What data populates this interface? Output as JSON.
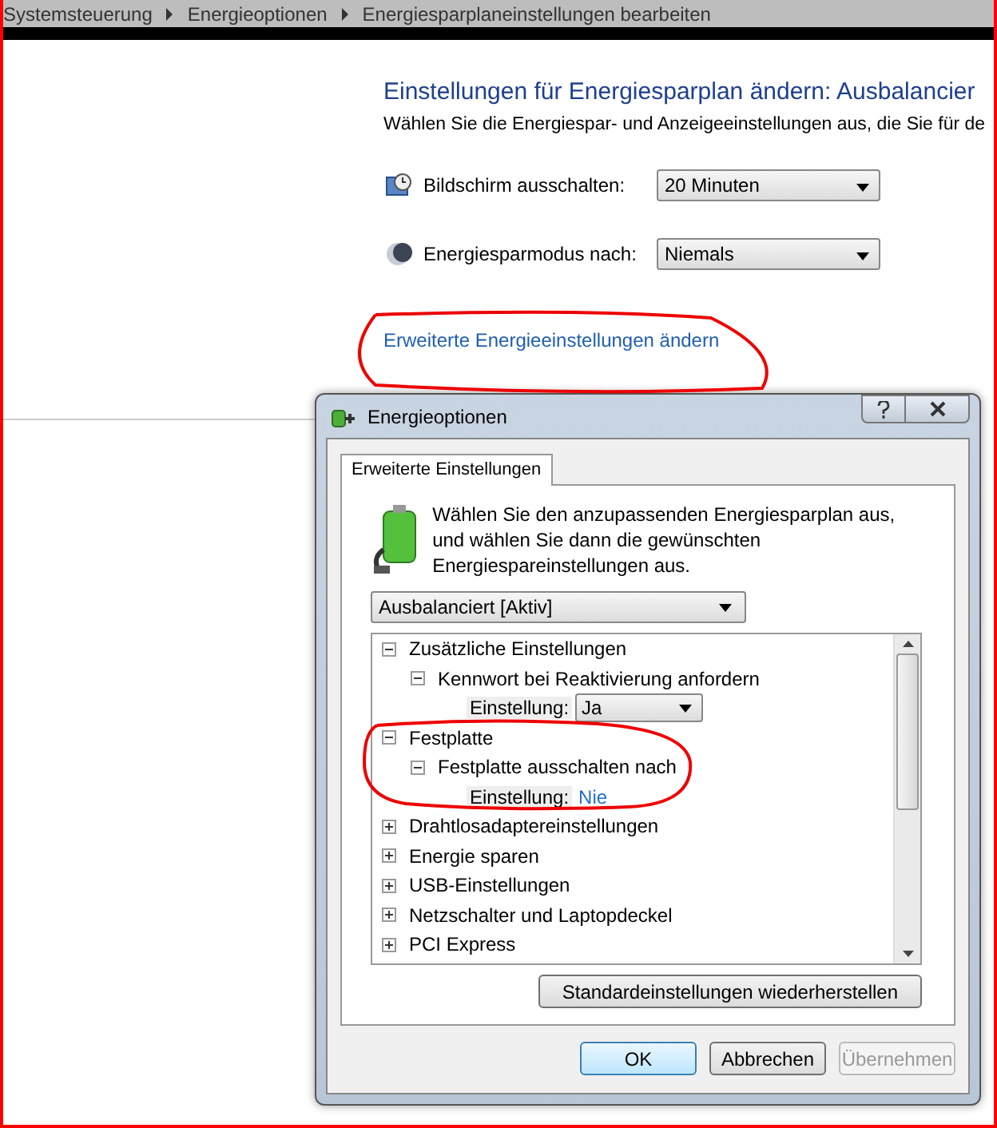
{
  "breadcrumb": [
    {
      "label": "Systemsteuerung"
    },
    {
      "label": "Energieoptionen"
    },
    {
      "label": "Energiesparplaneinstellungen bearbeiten"
    }
  ],
  "page": {
    "title": "Einstellungen für Energiesparplan ändern: Ausbalancier",
    "subtitle": "Wählen Sie die Energiespar- und Anzeigeeinstellungen aus, die Sie für de",
    "settings": [
      {
        "kind": "display",
        "label": "Bildschirm ausschalten:",
        "value": "20 Minuten"
      },
      {
        "kind": "sleep",
        "label": "Energiesparmodus nach:",
        "value": "Niemals"
      }
    ],
    "link": "Erweiterte Energieeinstellungen ändern"
  },
  "dialog": {
    "title": "Energieoptionen",
    "tabs": [
      {
        "label": "Erweiterte Einstellungen",
        "selected": true
      }
    ],
    "intro": "Wählen Sie den anzupassenden Energiesparplan aus, und wählen Sie dann die gewünschten Energiespareinstellungen aus.",
    "plan": "Ausbalanciert [Aktiv]",
    "tree": [
      {
        "kind": "group",
        "label": "Zusätzliche Einstellungen",
        "expanded": true,
        "children": [
          {
            "kind": "group",
            "label": "Kennwort bei Reaktivierung anfordern",
            "expanded": true,
            "children": [
              {
                "kind": "dropdown_setting",
                "label": "Einstellung:",
                "value": "Ja"
              }
            ]
          }
        ]
      },
      {
        "kind": "group",
        "label": "Festplatte",
        "expanded": true,
        "children": [
          {
            "kind": "group",
            "label": "Festplatte ausschalten nach",
            "expanded": true,
            "children": [
              {
                "kind": "link_setting",
                "label": "Einstellung:",
                "value": "Nie"
              }
            ]
          }
        ]
      },
      {
        "kind": "group",
        "label": "Drahtlosadaptereinstellungen",
        "expanded": false
      },
      {
        "kind": "group",
        "label": "Energie sparen",
        "expanded": false
      },
      {
        "kind": "group",
        "label": "USB-Einstellungen",
        "expanded": false
      },
      {
        "kind": "group",
        "label": "Netzschalter und Laptopdeckel",
        "expanded": false
      },
      {
        "kind": "group",
        "label": "PCI Express",
        "expanded": false
      }
    ],
    "restore_button": "Standardeinstellungen wiederherstellen",
    "buttons": [
      {
        "label": "OK",
        "default": true,
        "disabled": false
      },
      {
        "label": "Abbrechen",
        "default": false,
        "disabled": false
      },
      {
        "label": "Übernehmen",
        "default": false,
        "disabled": true
      }
    ]
  }
}
